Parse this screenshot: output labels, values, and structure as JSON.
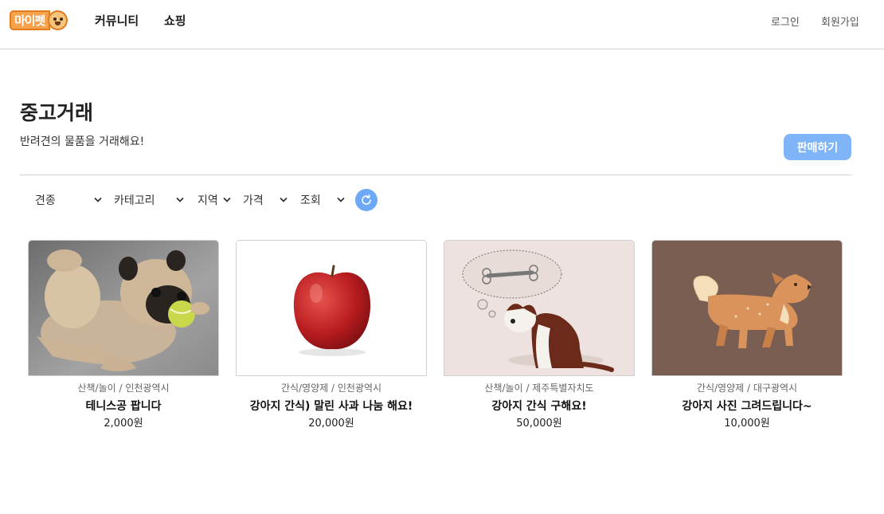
{
  "header": {
    "logo_text": "마이펫",
    "nav": [
      "커뮤니티",
      "쇼핑"
    ],
    "login": "로그인",
    "signup": "회원가입"
  },
  "page": {
    "title": "중고거래",
    "subtitle": "반려견의 물품을 거래해요!",
    "sell_button": "판매하기"
  },
  "filters": {
    "breed": "견종",
    "category": "카테고리",
    "region": "지역",
    "price": "가격",
    "views": "조회"
  },
  "items": [
    {
      "meta": "산책/놀이 / 인천광역시",
      "title": "테니스공 팝니다",
      "price": "2,000원"
    },
    {
      "meta": "간식/영양제 / 인천광역시",
      "title": "강아지 간식) 말린 사과 나눔 해요!",
      "price": "20,000원"
    },
    {
      "meta": "산책/놀이 / 제주특별자치도",
      "title": "강아지 간식 구해요!",
      "price": "50,000원"
    },
    {
      "meta": "간식/영양제 / 대구광역시",
      "title": "강아지 사진 그려드립니다~",
      "price": "10,000원"
    }
  ],
  "colors": {
    "accent": "#7fb4f6",
    "refresh": "#6ea9f7",
    "logo": "#f7a14a"
  },
  "icons": {
    "refresh": "refresh-icon",
    "chevron": "chevron-down-icon"
  }
}
